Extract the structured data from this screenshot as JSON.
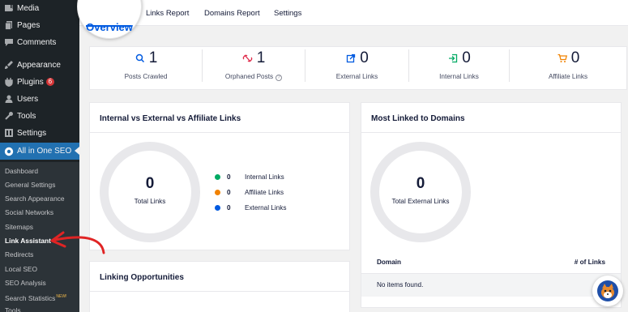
{
  "sidebar": {
    "items": [
      {
        "label": "Media",
        "icon": "media-icon"
      },
      {
        "label": "Pages",
        "icon": "pages-icon"
      },
      {
        "label": "Comments",
        "icon": "comments-icon"
      },
      {
        "label": "Appearance",
        "icon": "appearance-icon"
      },
      {
        "label": "Plugins",
        "icon": "plugins-icon",
        "badge": "6"
      },
      {
        "label": "Users",
        "icon": "users-icon"
      },
      {
        "label": "Tools",
        "icon": "tools-icon"
      },
      {
        "label": "Settings",
        "icon": "settings-icon"
      },
      {
        "label": "All in One SEO",
        "icon": "aioseo-icon"
      }
    ],
    "submenu": [
      {
        "label": "Dashboard"
      },
      {
        "label": "General Settings"
      },
      {
        "label": "Search Appearance"
      },
      {
        "label": "Social Networks"
      },
      {
        "label": "Sitemaps"
      },
      {
        "label": "Link Assistant"
      },
      {
        "label": "Redirects"
      },
      {
        "label": "Local SEO"
      },
      {
        "label": "SEO Analysis"
      },
      {
        "label": "Search Statistics",
        "tag": "NEW!"
      },
      {
        "label": "Tools"
      }
    ]
  },
  "tabs": {
    "overview": "Overview",
    "links_report": "Links Report",
    "domains_report": "Domains Report",
    "settings": "Settings"
  },
  "stats": [
    {
      "value": "1",
      "label": "Posts Crawled",
      "icon": "search-icon",
      "color": "#005ae0"
    },
    {
      "value": "1",
      "label": "Orphaned Posts",
      "icon": "broken-link-icon",
      "color": "#df2a4a"
    },
    {
      "value": "0",
      "label": "External Links",
      "icon": "external-link-icon",
      "color": "#005ae0"
    },
    {
      "value": "0",
      "label": "Internal Links",
      "icon": "internal-link-icon",
      "color": "#00aa63"
    },
    {
      "value": "0",
      "label": "Affiliate Links",
      "icon": "cart-icon",
      "color": "#f18200"
    }
  ],
  "links_card": {
    "title": "Internal vs External vs Affiliate Links",
    "total_value": "0",
    "total_label": "Total Links",
    "legend": [
      {
        "count": "0",
        "label": "Internal Links",
        "color": "#00aa63"
      },
      {
        "count": "0",
        "label": "Affiliate Links",
        "color": "#f18200"
      },
      {
        "count": "0",
        "label": "External Links",
        "color": "#005ae0"
      }
    ]
  },
  "domains_card": {
    "title": "Most Linked to Domains",
    "total_value": "0",
    "total_label": "Total External Links",
    "col_domain": "Domain",
    "col_links": "# of Links",
    "empty_text": "No items found."
  },
  "opportunities_card": {
    "title": "Linking Opportunities"
  },
  "colors": {
    "brand_blue": "#005ae0",
    "sidebar_bg": "#1d2327",
    "sidebar_active": "#2271b1",
    "annotation_red": "#e02424"
  }
}
